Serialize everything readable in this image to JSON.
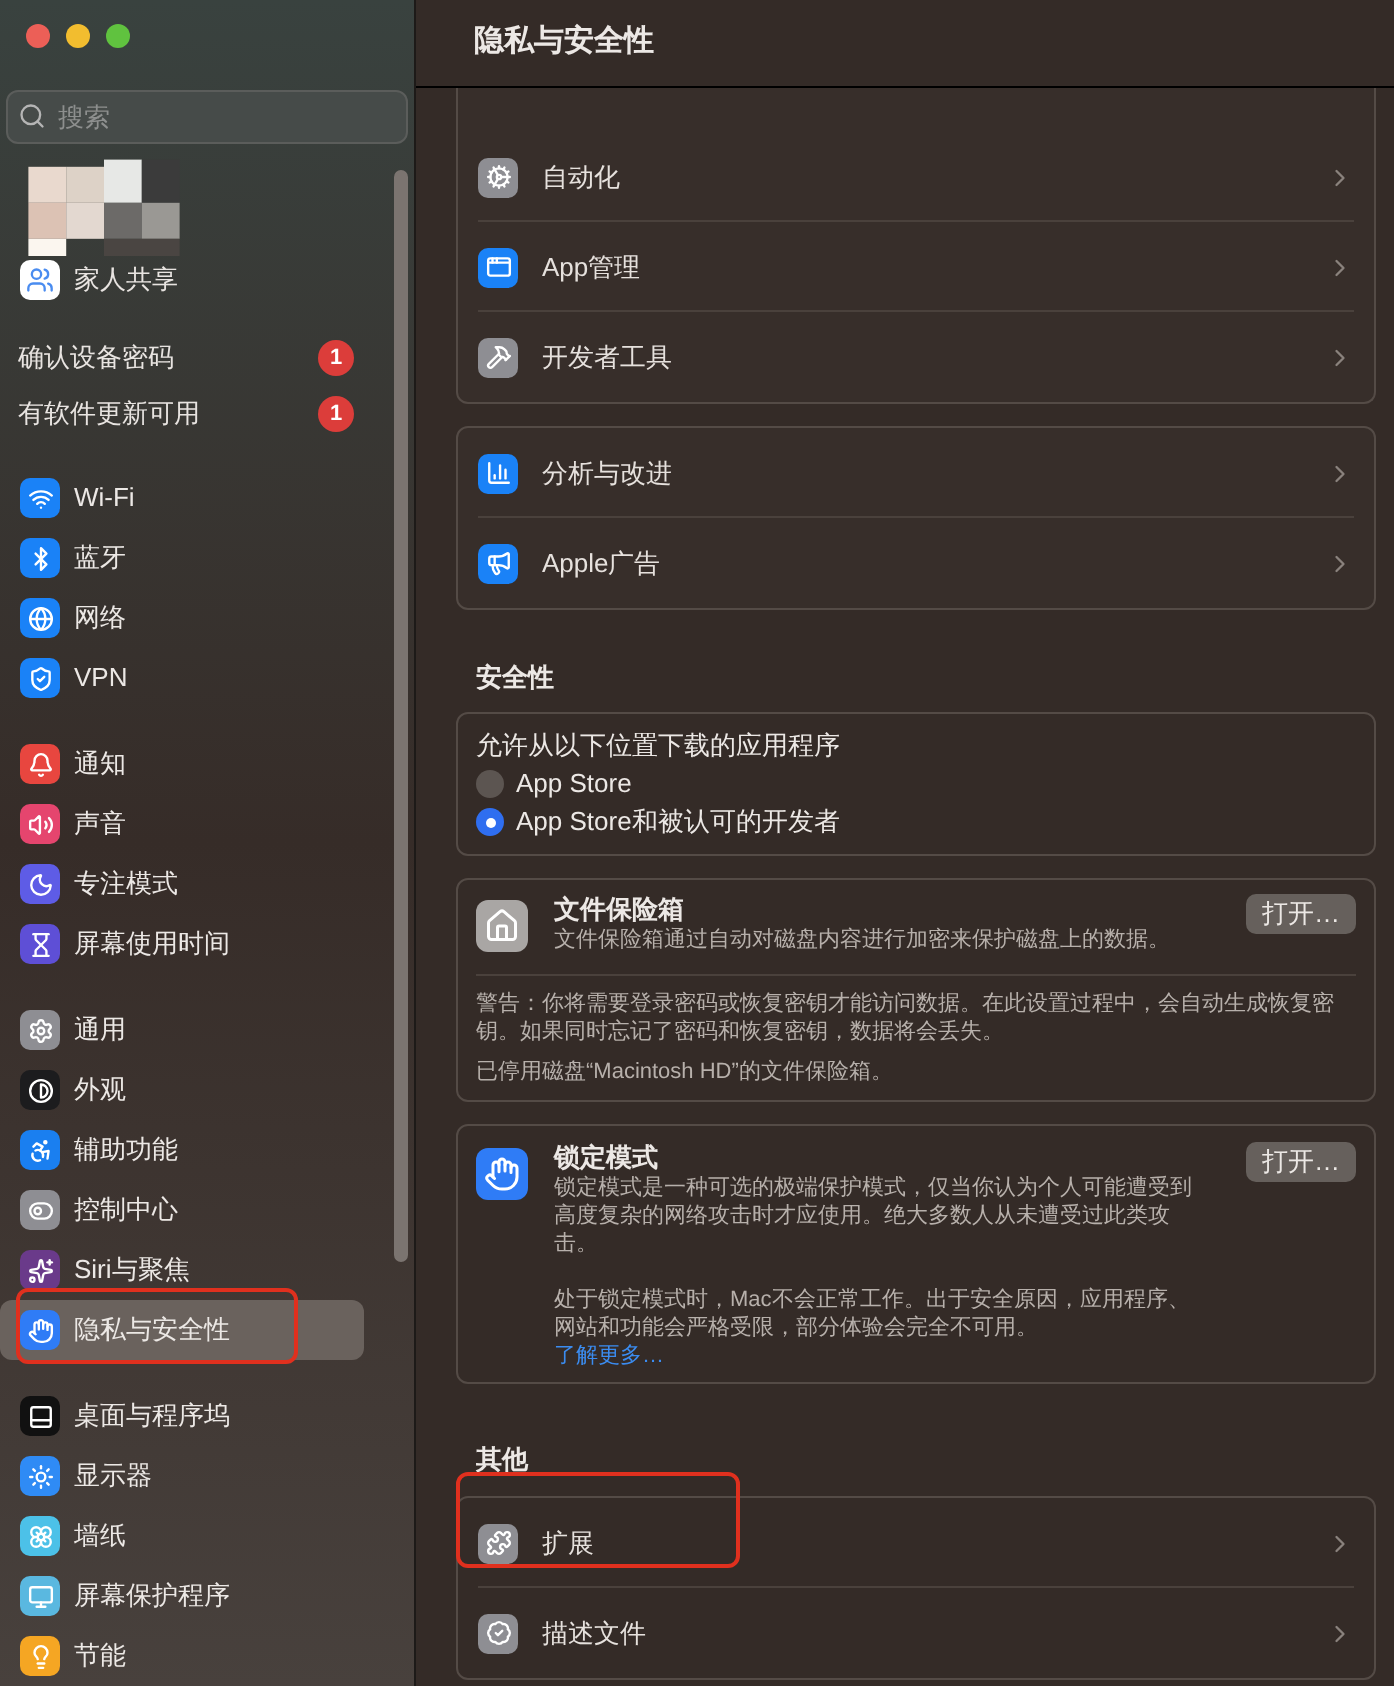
{
  "window": {
    "title": "隐私与安全性"
  },
  "sidebar": {
    "search": {
      "placeholder": "搜索"
    },
    "account": {
      "label": "家人共享"
    },
    "alerts": [
      {
        "label": "确认设备密码",
        "badge": "1"
      },
      {
        "label": "有软件更新可用",
        "badge": "1"
      }
    ],
    "groups": [
      {
        "items": [
          {
            "label": "Wi-Fi",
            "color": "#1a82f7",
            "selected": false,
            "highlighted": false
          },
          {
            "label": "蓝牙",
            "color": "#1a82f7",
            "selected": false,
            "highlighted": false
          },
          {
            "label": "网络",
            "color": "#1a82f7",
            "selected": false,
            "highlighted": false
          },
          {
            "label": "VPN",
            "color": "#1a82f7",
            "selected": false,
            "highlighted": false
          }
        ]
      },
      {
        "items": [
          {
            "label": "通知",
            "color": "#e8463f",
            "selected": false,
            "highlighted": false
          },
          {
            "label": "声音",
            "color": "#e5456e",
            "selected": false,
            "highlighted": false
          },
          {
            "label": "专注模式",
            "color": "#5e5ce6",
            "selected": false,
            "highlighted": false
          },
          {
            "label": "屏幕使用时间",
            "color": "#5e4fd6",
            "selected": false,
            "highlighted": false
          }
        ]
      },
      {
        "items": [
          {
            "label": "通用",
            "color": "#8e8e93",
            "selected": false,
            "highlighted": false
          },
          {
            "label": "外观",
            "color": "#1c1c1e",
            "selected": false,
            "highlighted": false
          },
          {
            "label": "辅助功能",
            "color": "#1a7ff0",
            "selected": false,
            "highlighted": false
          },
          {
            "label": "控制中心",
            "color": "#8e8e93",
            "selected": false,
            "highlighted": false
          },
          {
            "label": "Siri与聚焦",
            "color": "#6a3a8a",
            "selected": false,
            "highlighted": false
          },
          {
            "label": "隐私与安全性",
            "color": "#2f7cf6",
            "selected": true,
            "highlighted": true
          }
        ]
      },
      {
        "items": [
          {
            "label": "桌面与程序坞",
            "color": "#111111",
            "selected": false,
            "highlighted": false
          },
          {
            "label": "显示器",
            "color": "#2f8bf5",
            "selected": false,
            "highlighted": false
          },
          {
            "label": "墙纸",
            "color": "#4cc1e8",
            "selected": false,
            "highlighted": false
          },
          {
            "label": "屏幕保护程序",
            "color": "#5ab8e0",
            "selected": false,
            "highlighted": false
          },
          {
            "label": "节能",
            "color": "#f5a623",
            "selected": false,
            "highlighted": false
          }
        ]
      }
    ]
  },
  "content": {
    "groups": [
      {
        "rows": [
          {
            "label": "自动化",
            "color": "#8e8e93",
            "highlighted": false
          },
          {
            "label": "App管理",
            "color": "#1a82f7",
            "highlighted": false
          },
          {
            "label": "开发者工具",
            "color": "#8e8e93",
            "highlighted": false
          }
        ]
      },
      {
        "rows": [
          {
            "label": "分析与改进",
            "color": "#1a82f7",
            "highlighted": false
          },
          {
            "label": "Apple广告",
            "color": "#1a82f7",
            "highlighted": false
          }
        ]
      }
    ],
    "security": {
      "heading": "安全性",
      "download": {
        "label": "允许从以下位置下载的应用程序",
        "options": [
          {
            "label": "App Store",
            "selected": false
          },
          {
            "label": "App Store和被认可的开发者",
            "selected": true
          }
        ]
      },
      "filevault": {
        "title": "文件保险箱",
        "description": "文件保险箱通过自动对磁盘内容进行加密来保护磁盘上的数据。",
        "button": "打开…",
        "warning": "警告：你将需要登录密码或恢复密钥才能访问数据。在此设置过程中，会自动生成恢复密钥。如果同时忘记了密码和恢复密钥，数据将会丢失。",
        "status": "已停用磁盘“Macintosh HD”的文件保险箱。"
      },
      "lockdown": {
        "title": "锁定模式",
        "description": "锁定模式是一种可选的极端保护模式，仅当你认为个人可能遭受到高度复杂的网络攻击时才应使用。绝大多数人从未遭受过此类攻击。",
        "button": "打开…",
        "note": "处于锁定模式时，Mac不会正常工作。出于安全原因，应用程序、网站和功能会严格受限，部分体验会完全不可用。",
        "link": "了解更多…"
      }
    },
    "other": {
      "heading": "其他",
      "rows": [
        {
          "label": "扩展",
          "color": "#8e8e93",
          "highlighted": true
        },
        {
          "label": "描述文件",
          "color": "#8e8e93",
          "highlighted": false
        }
      ]
    }
  }
}
